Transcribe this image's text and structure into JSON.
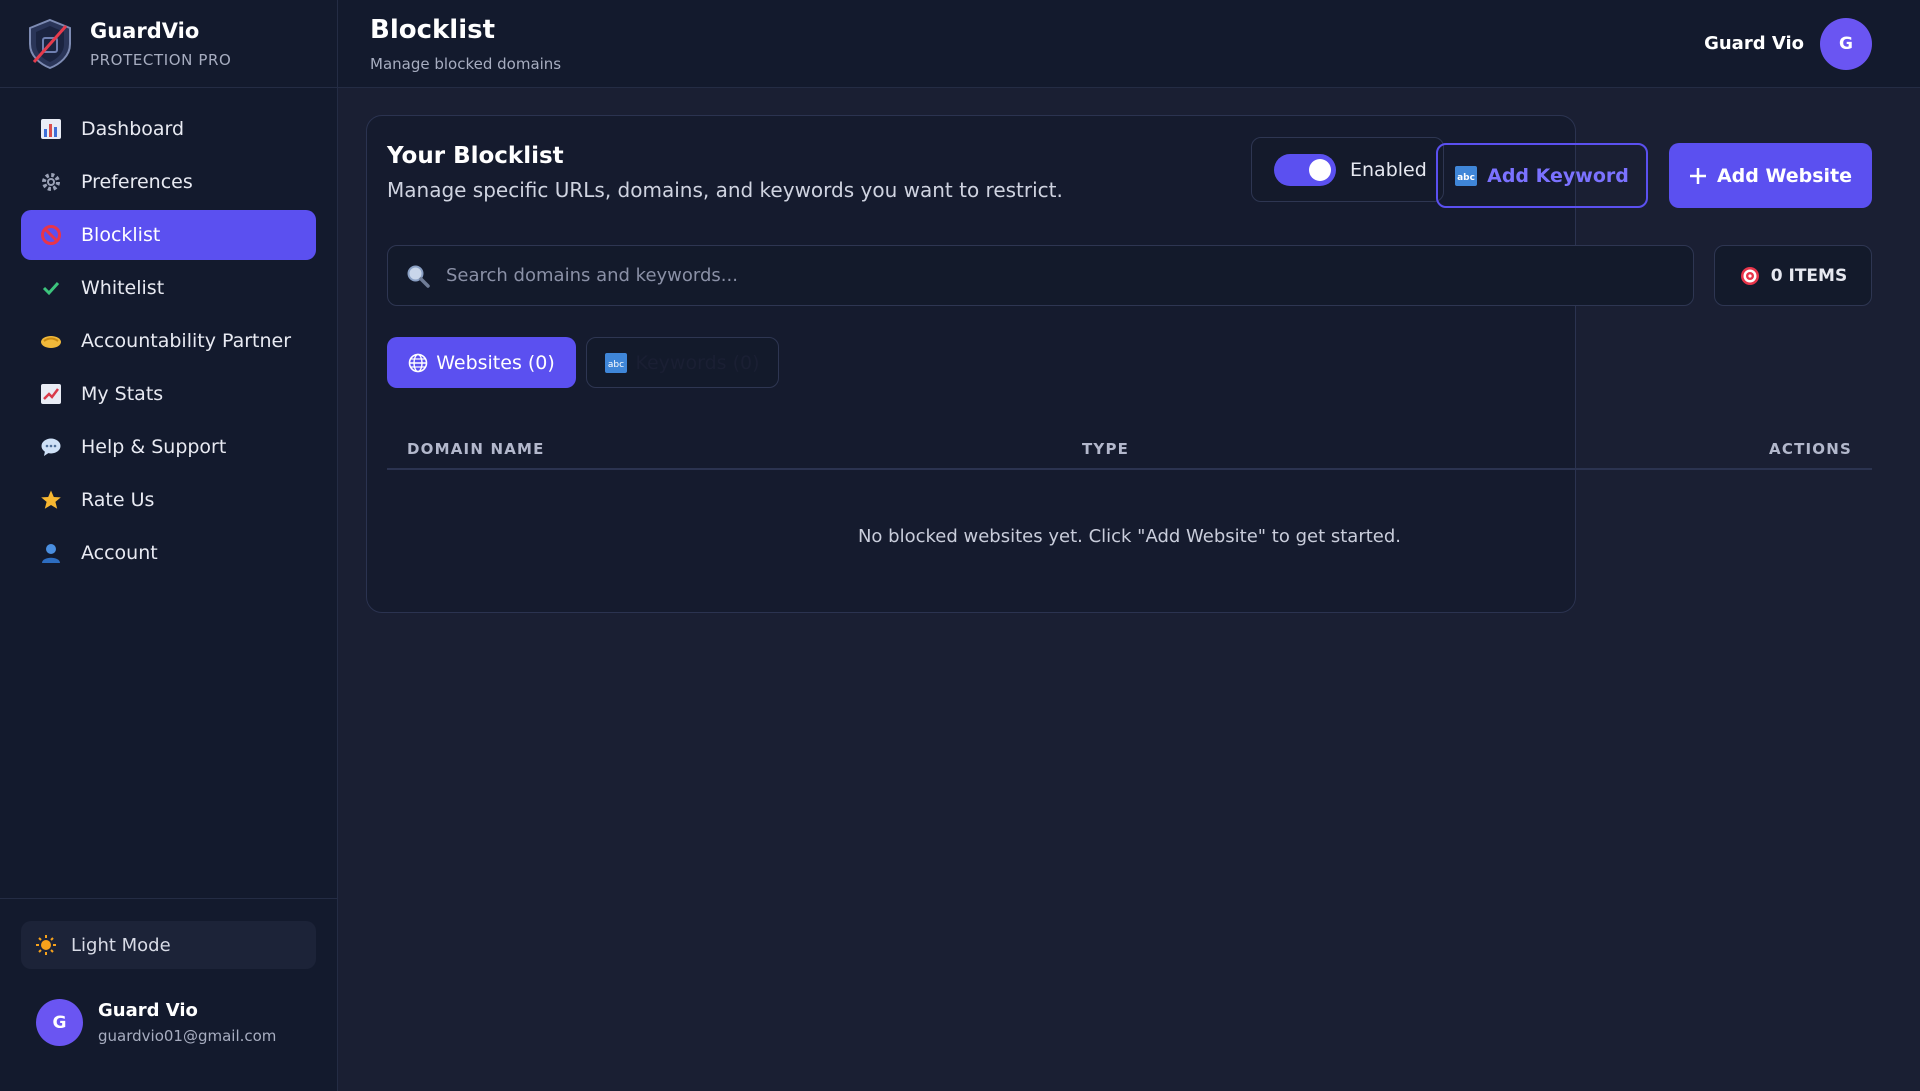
{
  "brand": {
    "name": "GuardVio",
    "subtitle": "PROTECTION PRO"
  },
  "sidebar": {
    "items": [
      {
        "label": "Dashboard",
        "icon": "bar-chart-icon",
        "active": false
      },
      {
        "label": "Preferences",
        "icon": "gear-icon",
        "active": false
      },
      {
        "label": "Blocklist",
        "icon": "prohibited-icon",
        "active": true
      },
      {
        "label": "Whitelist",
        "icon": "check-icon",
        "active": false
      },
      {
        "label": "Accountability Partner",
        "icon": "handshake-icon",
        "active": false
      },
      {
        "label": "My Stats",
        "icon": "trend-chart-icon",
        "active": false
      },
      {
        "label": "Help & Support",
        "icon": "speech-bubble-icon",
        "active": false
      },
      {
        "label": "Rate Us",
        "icon": "star-icon",
        "active": false
      },
      {
        "label": "Account",
        "icon": "user-icon",
        "active": false
      }
    ],
    "mode_toggle": {
      "label": "Light Mode",
      "icon": "sun-icon"
    },
    "user": {
      "initial": "G",
      "name": "Guard Vio",
      "email": "guardvio01@gmail.com"
    }
  },
  "header": {
    "title": "Blocklist",
    "subtitle": "Manage blocked domains",
    "user_name": "Guard Vio",
    "user_initial": "G"
  },
  "card": {
    "title": "Your Blocklist",
    "description": "Manage specific URLs, domains, and keywords you want to restrict.",
    "toggle_label": "Enabled",
    "add_keyword_label": "Add Keyword",
    "add_website_label": "Add Website",
    "search_placeholder": "Search domains and keywords...",
    "items_count": "0 ITEMS",
    "tabs": [
      {
        "label": "Websites (0)",
        "icon": "globe-icon",
        "active": true
      },
      {
        "label": "Keywords (0)",
        "icon": "abc-icon",
        "active": false
      }
    ],
    "columns": [
      "DOMAIN NAME",
      "TYPE",
      "ACTIONS"
    ],
    "empty_message": "No blocked websites yet. Click \"Add Website\" to get started."
  },
  "colors": {
    "accent": "#5b50f0",
    "background": "#1a1f33",
    "sidebar": "#131a2d"
  }
}
